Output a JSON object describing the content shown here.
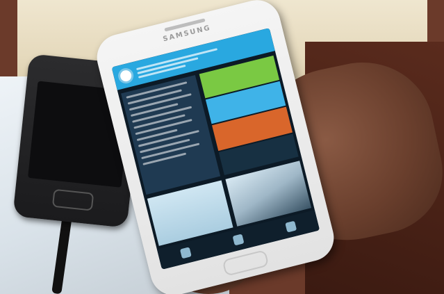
{
  "scene": {
    "description_free": true
  },
  "phones": {
    "black_phone_brand": "",
    "white_phone_brand": "SAMSUNG"
  },
  "colors": {
    "app_header": "#29a8e0",
    "tile_green": "#7ac943",
    "tile_blue": "#3fb3e8",
    "tile_orange": "#d9662b",
    "panel_dark": "#1f3a52"
  },
  "icons": [
    "logo-circle-icon",
    "nav-home-icon",
    "nav-people-icon",
    "nav-menu-icon"
  ]
}
